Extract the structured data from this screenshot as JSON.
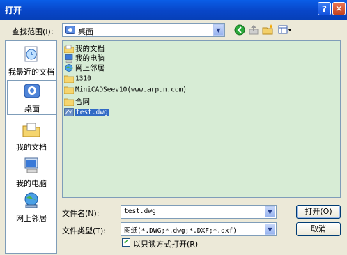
{
  "window": {
    "title": "打开"
  },
  "look_in": {
    "label": "查找范围(I):",
    "value": "桌面"
  },
  "places": [
    {
      "label": "我最近的文档",
      "icon": "recent-documents-icon"
    },
    {
      "label": "桌面",
      "icon": "desktop-icon"
    },
    {
      "label": "我的文档",
      "icon": "my-documents-icon"
    },
    {
      "label": "我的电脑",
      "icon": "my-computer-icon"
    },
    {
      "label": "网上邻居",
      "icon": "network-places-icon"
    }
  ],
  "files": [
    {
      "name": "我的文档",
      "icon": "my-documents-icon"
    },
    {
      "name": "我的电脑",
      "icon": "my-computer-icon"
    },
    {
      "name": "网上邻居",
      "icon": "network-places-icon"
    },
    {
      "name": "1310",
      "icon": "folder-icon"
    },
    {
      "name": "MiniCADSeev10(www.arpun.com)",
      "icon": "folder-icon"
    },
    {
      "name": "合同",
      "icon": "folder-icon"
    },
    {
      "name": "test.dwg",
      "icon": "dwg-file-icon",
      "selected": true
    }
  ],
  "filename": {
    "label": "文件名(N):",
    "value": "test.dwg"
  },
  "filetype": {
    "label": "文件类型(T):",
    "value": "图纸(*.DWG;*.dwg;*.DXF;*.dxf)"
  },
  "readonly": {
    "label": "以只读方式打开(R)",
    "checked": true
  },
  "buttons": {
    "open": "打开(O)",
    "cancel": "取消"
  },
  "colors": {
    "titlebar": "#0a5ee7",
    "listbg": "#d7ecd5",
    "selection": "#316ac5"
  }
}
